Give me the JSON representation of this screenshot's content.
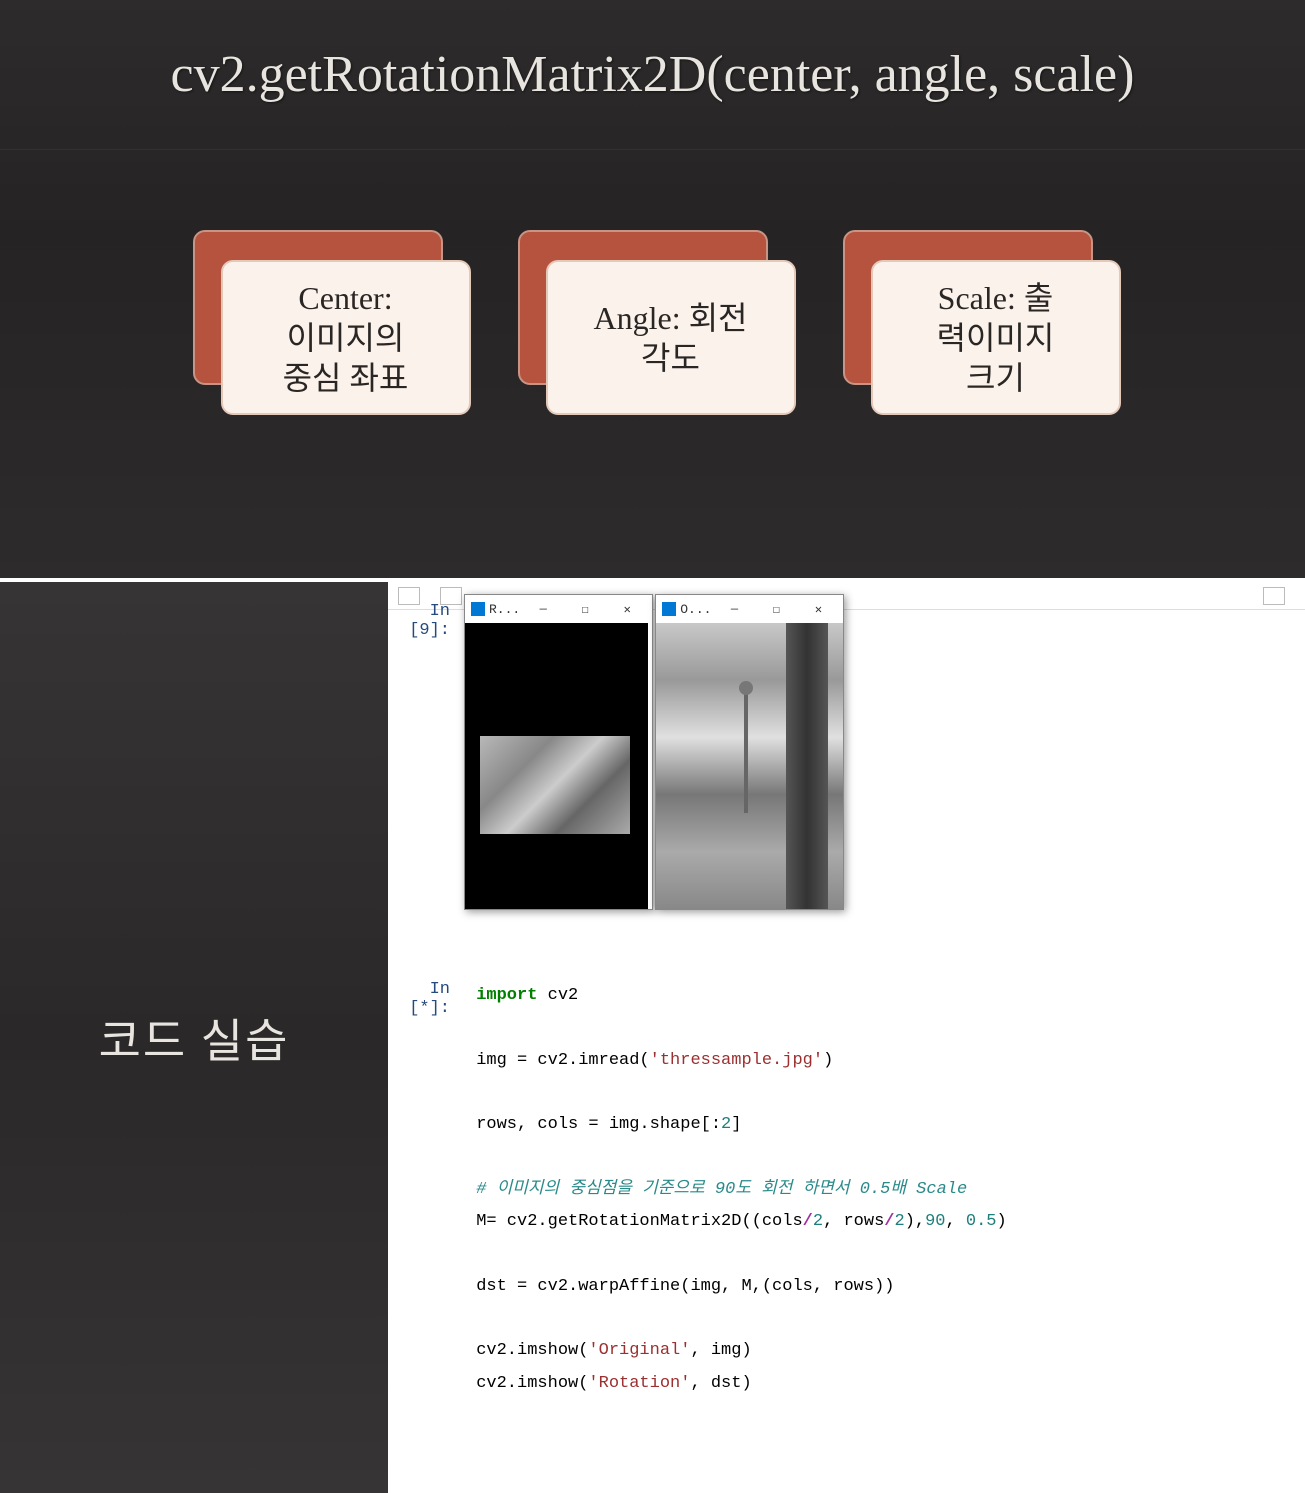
{
  "slide1": {
    "title": "cv2.getRotationMatrix2D(center, angle, scale)",
    "cards": [
      {
        "text": "Center:\n이미지의\n중심 좌표"
      },
      {
        "text": "Angle: 회전\n각도"
      },
      {
        "text": "Scale: 출\n력이미지\n크기"
      }
    ]
  },
  "slide2": {
    "title": "코드 실습",
    "prompt_top": "In [9]:",
    "prompt_main": "In [*]:",
    "windows": {
      "rotated": {
        "title": "R..."
      },
      "original": {
        "title": "O..."
      }
    },
    "code": {
      "line1_kw": "import",
      "line1_mod": " cv2",
      "line2_a": "img = cv2.imread(",
      "line2_str": "'thressample.jpg'",
      "line2_b": ")",
      "line3_a": "rows, cols = img.shape[:",
      "line3_num": "2",
      "line3_b": "]",
      "line4_comment": "# 이미지의 중심점을 기준으로 90도 회전 하면서 0.5배 Scale",
      "line5_a": "M= cv2.getRotationMatrix2D((cols",
      "line5_op1": "/",
      "line5_n1": "2",
      "line5_b": ", rows",
      "line5_op2": "/",
      "line5_n2": "2",
      "line5_c": "),",
      "line5_n3": "90",
      "line5_d": ", ",
      "line5_n4": "0.5",
      "line5_e": ")",
      "line6": "dst = cv2.warpAffine(img, M,(cols, rows))",
      "line7_a": "cv2.imshow(",
      "line7_str": "'Original'",
      "line7_b": ", img)",
      "line8_a": "cv2.imshow(",
      "line8_str": "'Rotation'",
      "line8_b": ", dst)"
    }
  }
}
